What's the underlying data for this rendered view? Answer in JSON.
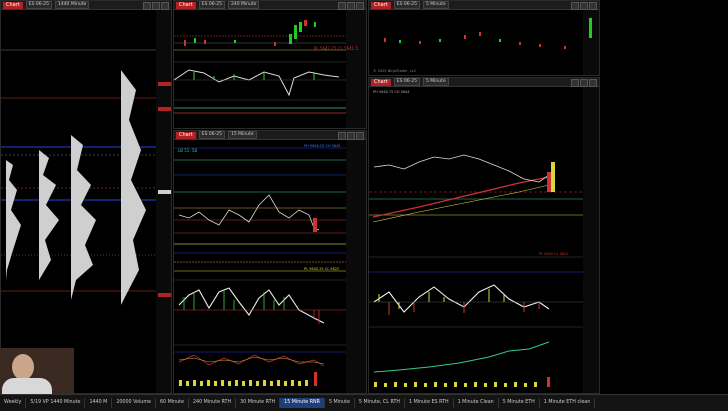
{
  "colors": {
    "chart_btn": "#b32222",
    "bull": "#22c55e",
    "bear": "#e03030",
    "axis_bg": "#000000",
    "active_tab": "#1f3f7a"
  },
  "windows": {
    "profile": {
      "chart_btn": "Chart",
      "symbol": "ES 06-25",
      "interval": "1440 Minute"
    },
    "top_mid": {
      "chart_btn": "Chart",
      "symbol": "ES 06-25",
      "interval": "240 Minute",
      "pl_label": "PL 5642.25 CL 5641.5"
    },
    "top_right": {
      "chart_btn": "Chart",
      "symbol": "ES 06-25",
      "interval": "5 Minute",
      "copyright": "© 2025 NinjaTrader, LLC"
    },
    "mid": {
      "chart_btn": "Chart",
      "symbol": "ES 06-25",
      "interval": "15 Minute",
      "corner_label": "LB 51: 58",
      "ph_label": "PH 5846.25 CH 5645",
      "pl_label": "PL 5645.25 CL 5622"
    },
    "right": {
      "chart_btn": "Chart",
      "symbol": "ES 06-25",
      "interval": "5 Minute",
      "corner_label": "PH 5648.75 CH 5644",
      "pl_label": "PL 5642 CL 5622"
    }
  },
  "taskbar": {
    "tabs": [
      "Weekly",
      "5/19 VP 1440 Minute",
      "1440 M",
      "20000 Volume",
      "60 Minute",
      "240 Minute RTH",
      "30 Minute RTH",
      "15 Minute RNR",
      "5 Minute",
      "5 Minute, CL RTH",
      "1 Minute ES RTH",
      "1 Minute Clean",
      "5 Minute ETH",
      "1 Minute ETH clean"
    ],
    "active_tab": "15 Minute RNR"
  }
}
